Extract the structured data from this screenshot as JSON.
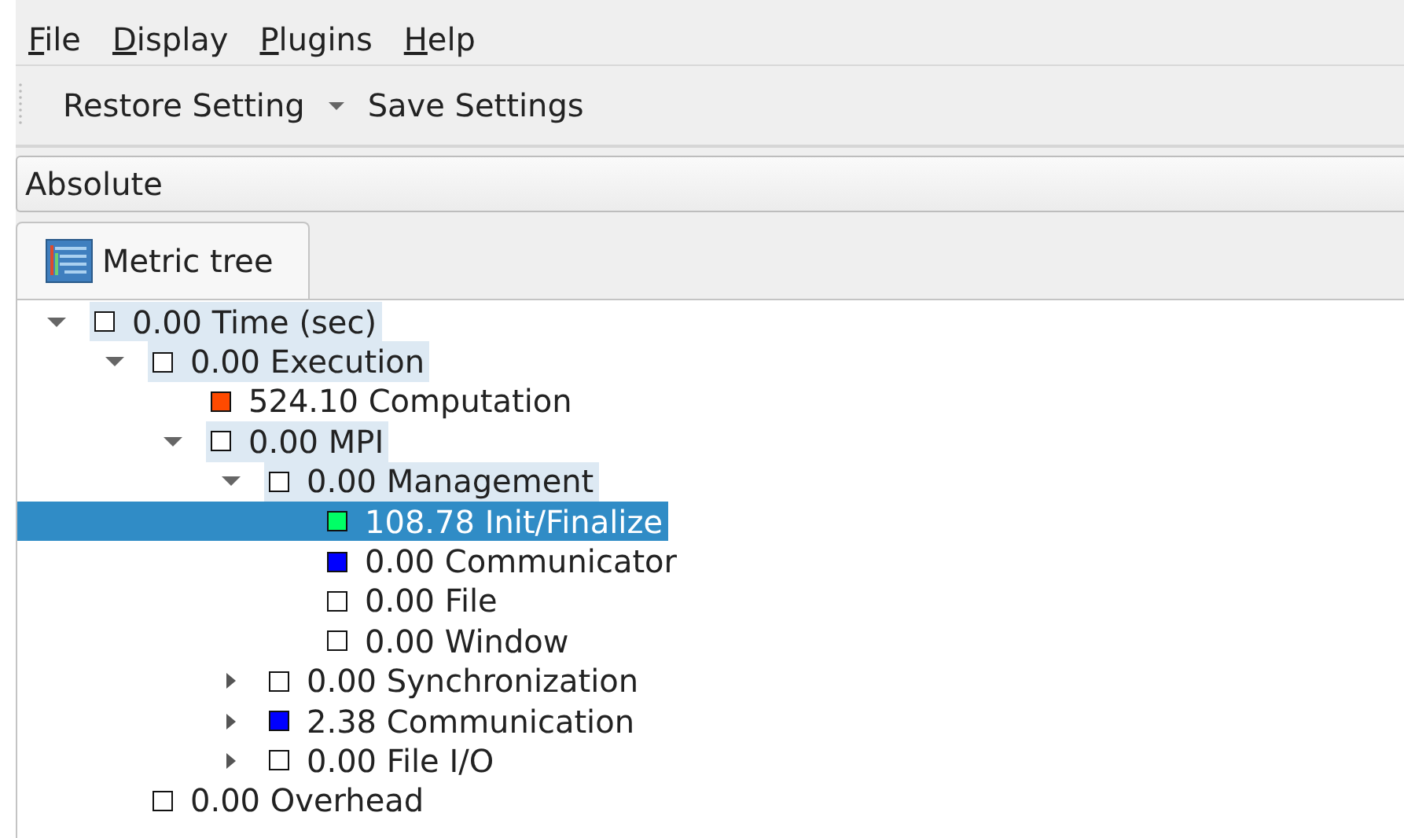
{
  "menu": [
    {
      "label": "File"
    },
    {
      "label": "Display"
    },
    {
      "label": "Plugins"
    },
    {
      "label": "Help"
    }
  ],
  "toolbar": {
    "restore": "Restore Setting",
    "save": "Save Settings"
  },
  "value_mode": {
    "value": "Absolute"
  },
  "tabs": [
    {
      "label": "Metric tree",
      "selected": true
    }
  ],
  "tree": [
    {
      "label": "0.00 Time (sec)",
      "color": "#ffffff",
      "expanded": true,
      "highlighted": true,
      "selected": false,
      "children": [
        {
          "label": "0.00 Execution",
          "color": "#ffffff",
          "expanded": true,
          "highlighted": true,
          "selected": false,
          "children": [
            {
              "label": "524.10 Computation",
              "color": "#ff4a00",
              "highlighted": false,
              "selected": false
            },
            {
              "label": "0.00 MPI",
              "color": "#ffffff",
              "expanded": true,
              "highlighted": true,
              "selected": false,
              "children": [
                {
                  "label": "0.00 Management",
                  "color": "#ffffff",
                  "expanded": true,
                  "highlighted": true,
                  "selected": false,
                  "children": [
                    {
                      "label": "108.78 Init/Finalize",
                      "color": "#00ff66",
                      "highlighted": false,
                      "selected": true
                    },
                    {
                      "label": "0.00 Communicator",
                      "color": "#0000ff",
                      "highlighted": false,
                      "selected": false
                    },
                    {
                      "label": "0.00 File",
                      "color": "#ffffff",
                      "highlighted": false,
                      "selected": false
                    },
                    {
                      "label": "0.00 Window",
                      "color": "#ffffff",
                      "highlighted": false,
                      "selected": false
                    }
                  ]
                },
                {
                  "label": "0.00 Synchronization",
                  "color": "#ffffff",
                  "expanded": false,
                  "highlighted": false,
                  "selected": false
                },
                {
                  "label": "2.38 Communication",
                  "color": "#0000ff",
                  "expanded": false,
                  "highlighted": false,
                  "selected": false
                },
                {
                  "label": "0.00 File I/O",
                  "color": "#ffffff",
                  "expanded": false,
                  "highlighted": false,
                  "selected": false
                }
              ]
            }
          ]
        },
        {
          "label": "0.00 Overhead",
          "color": "#ffffff",
          "highlighted": false,
          "selected": false
        }
      ]
    }
  ]
}
